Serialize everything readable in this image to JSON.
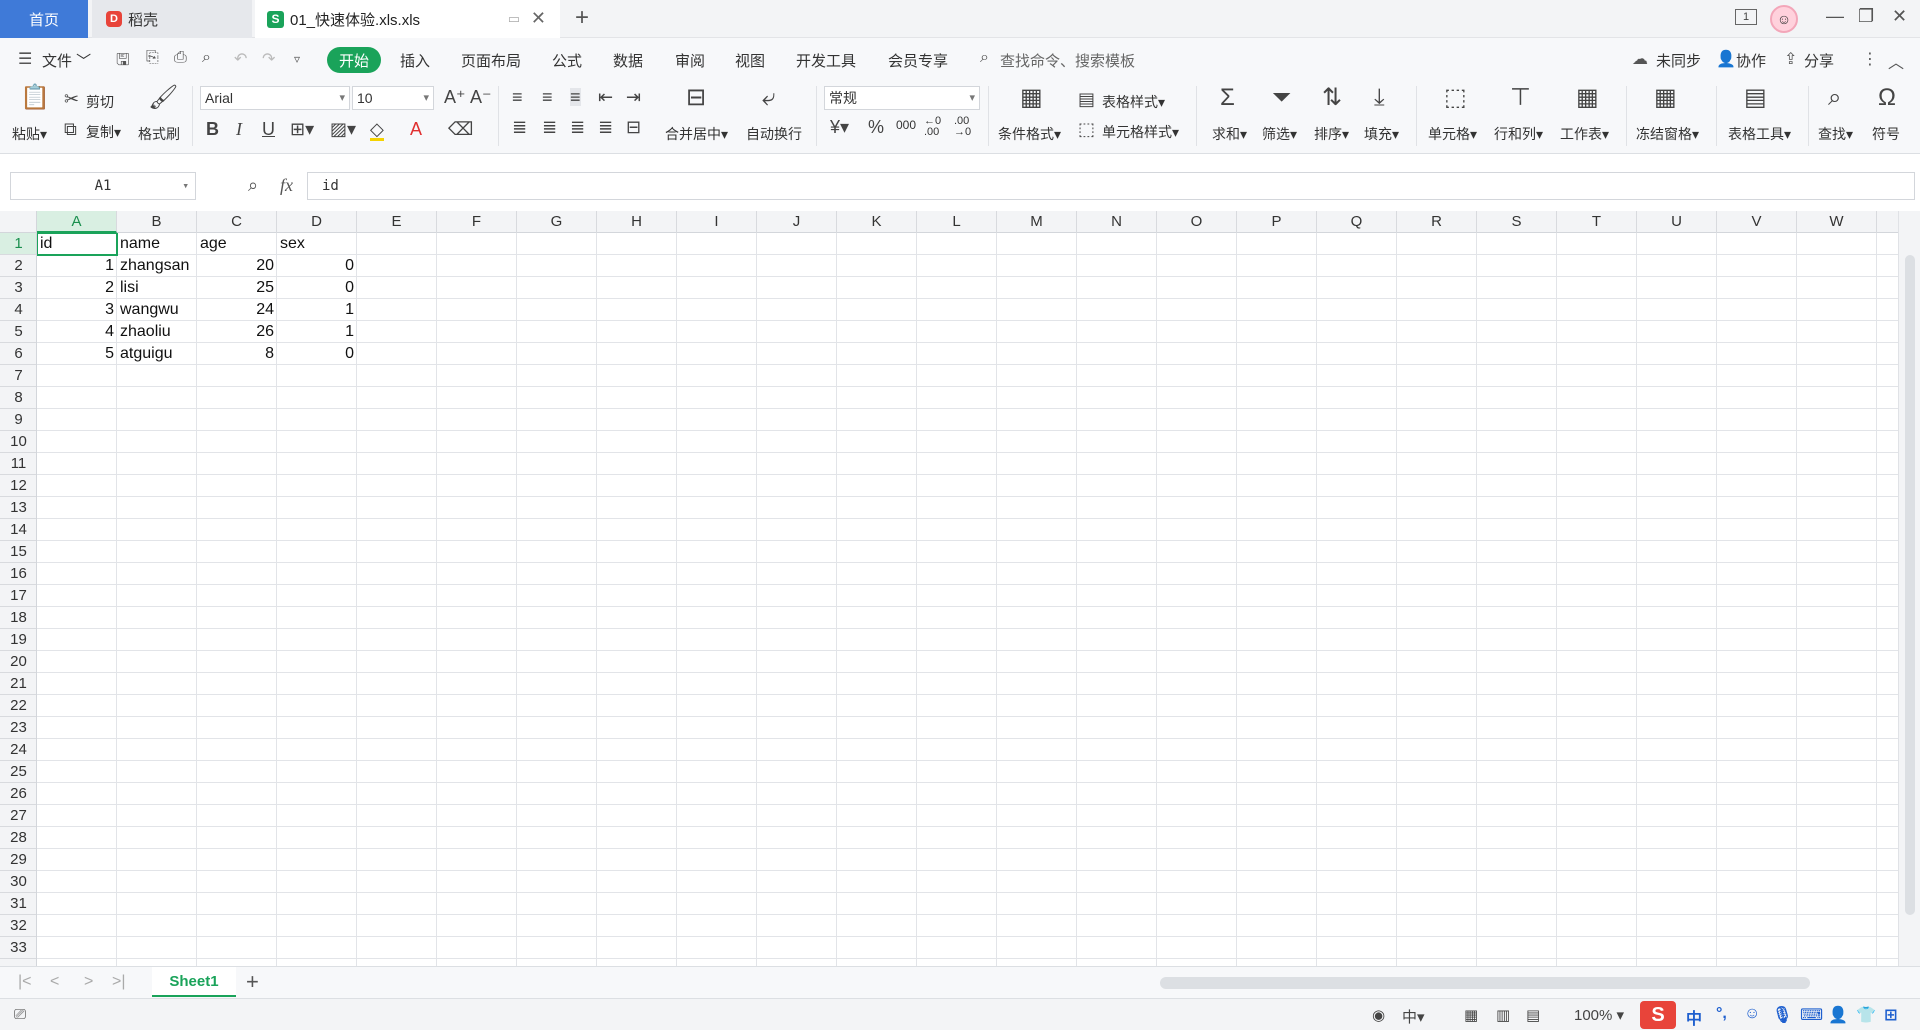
{
  "titlebar": {
    "home_tab": "首页",
    "daoke_tab": "稻壳",
    "doc_tab": "01_快速体验.xls.xls",
    "window_num": "1"
  },
  "menu": {
    "file": "文件",
    "items": [
      "开始",
      "插入",
      "页面布局",
      "公式",
      "数据",
      "审阅",
      "视图",
      "开发工具",
      "会员专享"
    ],
    "search_placeholder": "查找命令、搜索模板",
    "sync": "未同步",
    "collab": "协作",
    "share": "分享"
  },
  "ribbon": {
    "paste": "粘贴",
    "cut": "剪切",
    "copy": "复制",
    "format_painter": "格式刷",
    "font_name": "Arial",
    "font_size": "10",
    "merge_center": "合并居中",
    "wrap_text": "自动换行",
    "number_format": "常规",
    "cond_format": "条件格式",
    "table_style": "表格样式",
    "cell_style": "单元格样式",
    "sum": "求和",
    "filter": "筛选",
    "sort": "排序",
    "fill": "填充",
    "cell": "单元格",
    "row_col": "行和列",
    "worksheet": "工作表",
    "freeze": "冻结窗格",
    "table_tools": "表格工具",
    "find": "查找",
    "symbol": "符号"
  },
  "formula_bar": {
    "name_box": "A1",
    "fx": "fx",
    "content": "id"
  },
  "columns": [
    "A",
    "B",
    "C",
    "D",
    "E",
    "F",
    "G",
    "H",
    "I",
    "J",
    "K",
    "L",
    "M",
    "N",
    "O",
    "P",
    "Q",
    "R",
    "S",
    "T",
    "U",
    "V",
    "W"
  ],
  "rows": [
    "1",
    "2",
    "3",
    "4",
    "5",
    "6",
    "7",
    "8",
    "9",
    "10",
    "11",
    "12",
    "13",
    "14",
    "15",
    "16",
    "17",
    "18",
    "19",
    "20",
    "21",
    "22",
    "23",
    "24",
    "25",
    "26",
    "27",
    "28",
    "29",
    "30",
    "31",
    "32",
    "33"
  ],
  "table": {
    "headers": [
      "id",
      "name",
      "age",
      "sex"
    ],
    "rows": [
      [
        "1",
        "zhangsan",
        "20",
        "0"
      ],
      [
        "2",
        "lisi",
        "25",
        "0"
      ],
      [
        "3",
        "wangwu",
        "24",
        "1"
      ],
      [
        "4",
        "zhaoliu",
        "26",
        "1"
      ],
      [
        "5",
        "atguigu",
        "8",
        "0"
      ]
    ]
  },
  "sheets": {
    "active": "Sheet1"
  },
  "status": {
    "zoom": "100%",
    "lang": "中"
  },
  "colors": {
    "accent": "#1aa35a",
    "home_tab": "#3f7ad8"
  }
}
